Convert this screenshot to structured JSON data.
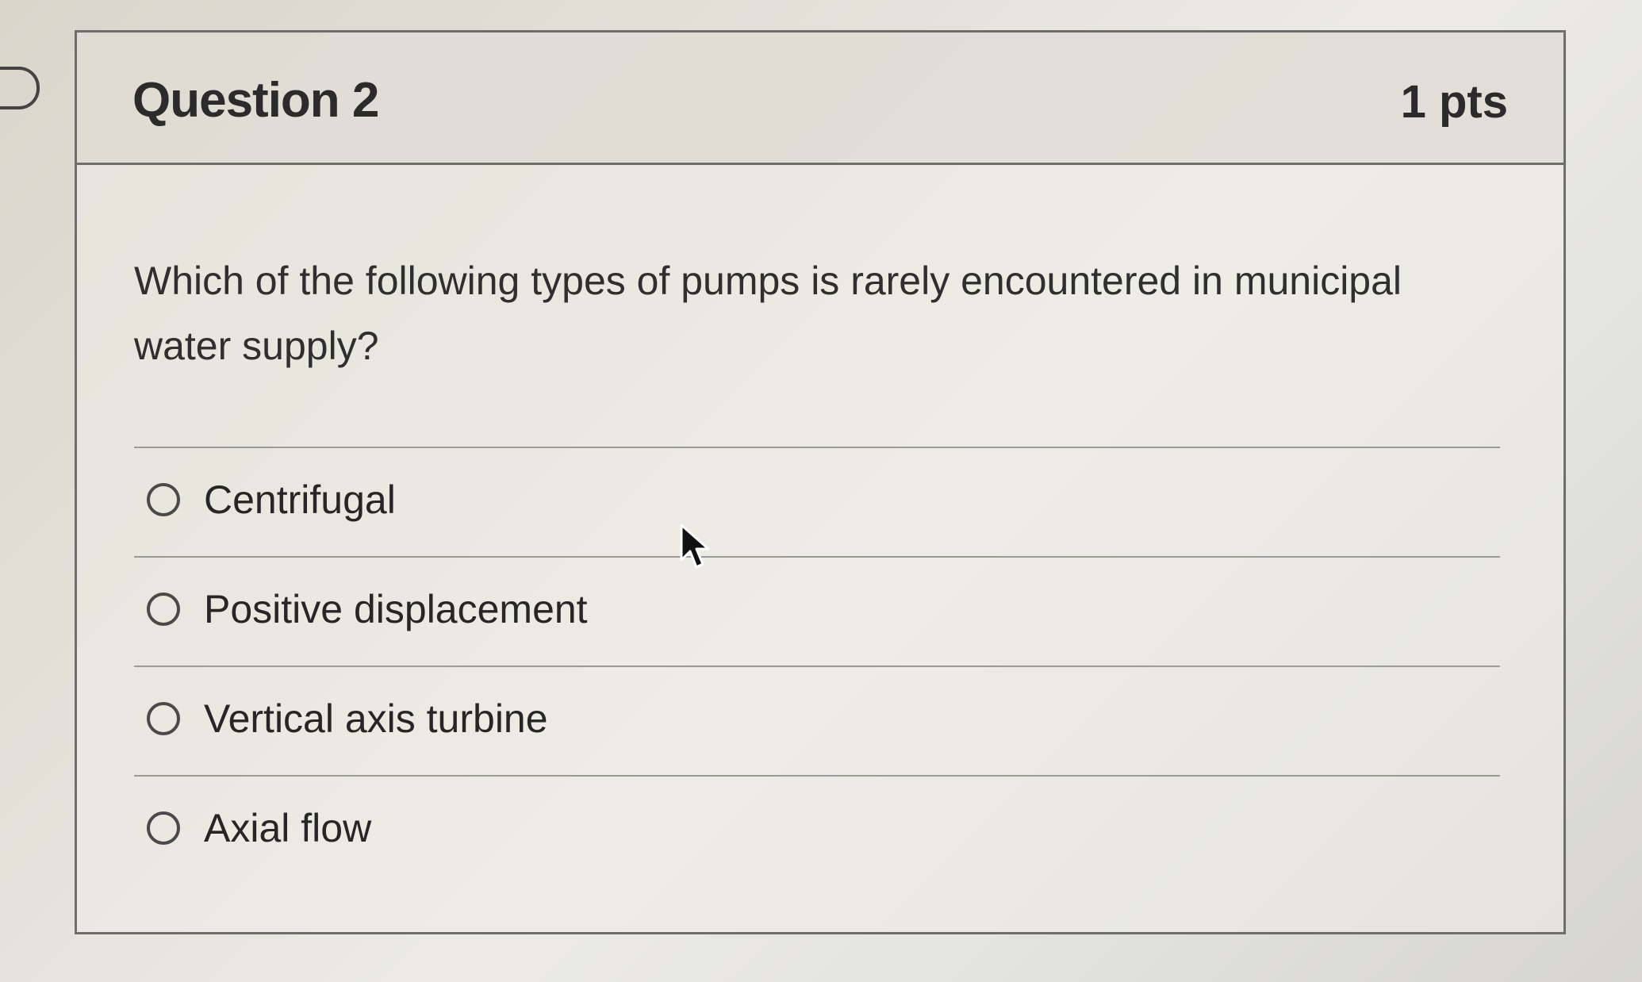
{
  "question": {
    "title": "Question 2",
    "points": "1 pts",
    "text": "Which of the following types of pumps is rarely encountered in municipal water supply?",
    "answers": [
      {
        "label": "Centrifugal",
        "selected": false
      },
      {
        "label": "Positive displacement",
        "selected": false
      },
      {
        "label": "Vertical axis turbine",
        "selected": false
      },
      {
        "label": "Axial flow",
        "selected": false
      }
    ]
  },
  "icons": {
    "bookmark": "bookmark-flag-icon",
    "cursor": "mouse-pointer-icon",
    "radio": "radio-button-empty-icon"
  }
}
